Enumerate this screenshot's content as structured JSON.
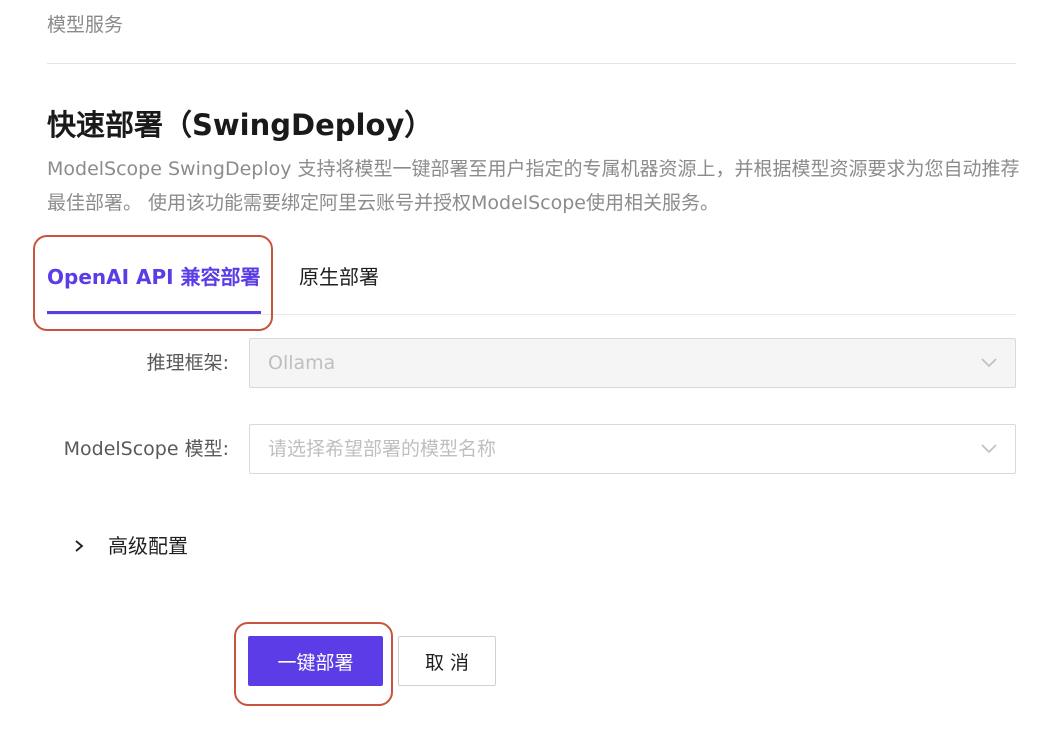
{
  "breadcrumb": "模型服务",
  "title": "快速部署（SwingDeploy）",
  "description": "ModelScope SwingDeploy 支持将模型一键部署至用户指定的专属机器资源上，并根据模型资源要求为您自动推荐最佳部署。 使用该功能需要绑定阿里云账号并授权ModelScope使用相关服务。",
  "tabs": [
    {
      "label": "OpenAI API 兼容部署",
      "active": true
    },
    {
      "label": "原生部署",
      "active": false
    }
  ],
  "form": {
    "framework": {
      "label": "推理框架:",
      "value": "Ollama",
      "disabled": true
    },
    "model": {
      "label": "ModelScope 模型:",
      "placeholder": "请选择希望部署的模型名称"
    }
  },
  "advanced": {
    "label": "高级配置",
    "icon": "chevron-right-icon"
  },
  "actions": {
    "deploy_label": "一键部署",
    "cancel_label": "取 消"
  },
  "colors": {
    "accent": "#5c3ce6",
    "highlight": "#c7543d"
  }
}
